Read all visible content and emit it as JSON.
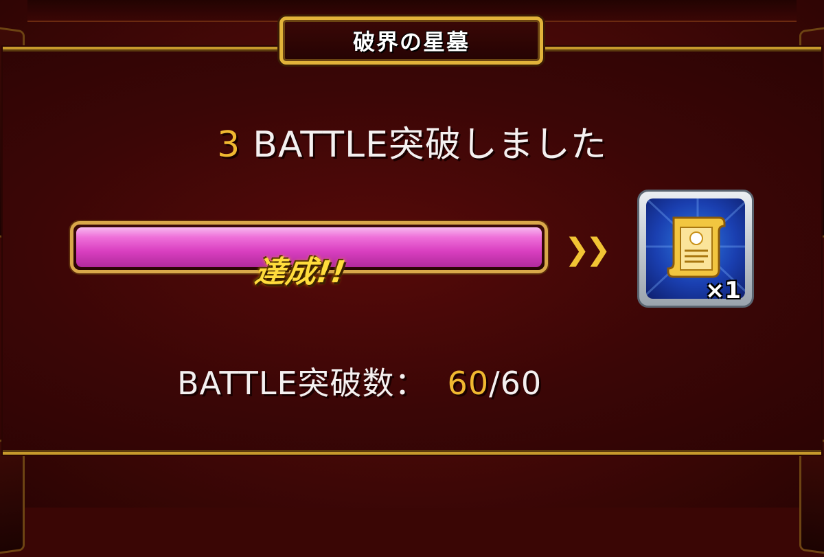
{
  "dialog": {
    "title": "破界の星墓",
    "headline_number": "3",
    "headline_text": "BATTLE突破しました",
    "progress": {
      "fraction": 1.0,
      "status_label": "達成!!"
    },
    "arrow_glyph": "»",
    "reward": {
      "icon": "scroll-icon",
      "quantity": "×1"
    },
    "count_label": "BATTLE突破数：",
    "count_current": "60",
    "count_total": "/60"
  },
  "colors": {
    "panel": "#4a0908",
    "gold_border": "#c79a2c",
    "highlight_number": "#f0b830",
    "progress_fill": "#e455cc",
    "reward_bg": "#1a3fb0"
  }
}
